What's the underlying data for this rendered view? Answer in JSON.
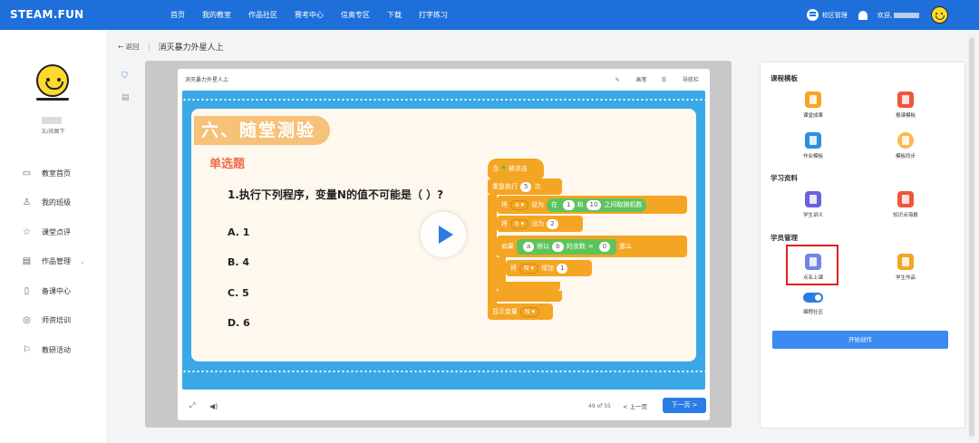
{
  "nav": {
    "logo": "STEAM.FUN",
    "links": [
      "首页",
      "我的教室",
      "作品社区",
      "赛考中心",
      "信奥专区",
      "下载",
      "打字练习"
    ],
    "campus_label": "校区管理",
    "welcome": "欢迎,"
  },
  "sidebar": {
    "role": "五/孩图下",
    "items": [
      {
        "label": "教室首页",
        "icon": "monitor-icon"
      },
      {
        "label": "我的班级",
        "icon": "user-icon"
      },
      {
        "label": "课堂点评",
        "icon": "star-icon"
      },
      {
        "label": "作品管理",
        "icon": "image-icon"
      },
      {
        "label": "备课中心",
        "icon": "book-icon"
      },
      {
        "label": "师资培训",
        "icon": "play-circle-icon"
      },
      {
        "label": "教研活动",
        "icon": "flag-icon"
      }
    ]
  },
  "breadcrumb": {
    "back": "← 返回",
    "title": "消灭暴力外星人上"
  },
  "player": {
    "title": "消灭暴力外星人上",
    "tool_pen": "画笔",
    "tool_nav": "导航栏",
    "page": "49 of 55",
    "prev": "< 上一页",
    "next": "下一页 >"
  },
  "slide": {
    "section": "六、随堂测验",
    "qtype": "单选题",
    "question": "1.执行下列程序，变量N的值不可能是（ ）?",
    "options": [
      "A. 1",
      "B. 4",
      "C. 5",
      "D. 6"
    ],
    "blocks": {
      "hat": "当",
      "hat2": "被点击",
      "repeat": "重复执行",
      "repeat_n": "5",
      "times": "次",
      "set1": "将",
      "var_a": "a",
      "setto": "设为",
      "rand_in": "在",
      "rand_from": "1",
      "rand_and": "和",
      "rand_to": "10",
      "rand_tail": "之间取随机数",
      "var_b": "b",
      "b_val": "2",
      "if": "如果",
      "mod_a": "a",
      "mod_txt": "除以",
      "mod_b": "b",
      "mod_tail": "的余数",
      "eq": "=",
      "eq_val": "0",
      "then": "那么",
      "change": "将",
      "var_n": "N",
      "incr": "增加",
      "incr_val": "1",
      "show": "显示变量",
      "show_var": "N"
    }
  },
  "rpanel": {
    "course_template": "课程模板",
    "items1": [
      "课堂成果",
      "报课模板",
      "作业模板",
      "模板同步"
    ],
    "study": "学习资料",
    "items2": [
      "学生讲义",
      "知识点海报"
    ],
    "student": "学员管理",
    "items3": [
      "点名上课",
      "学生作品"
    ],
    "toggle_label": "编程社区",
    "start": "开始创作"
  },
  "colors": {
    "nav": "#1e6fd9",
    "accent": "#2b7de3",
    "slide_bg": "#3aa8e6",
    "block_orange": "#f5a524",
    "block_green": "#5cc45c",
    "highlight": "#e02020"
  }
}
